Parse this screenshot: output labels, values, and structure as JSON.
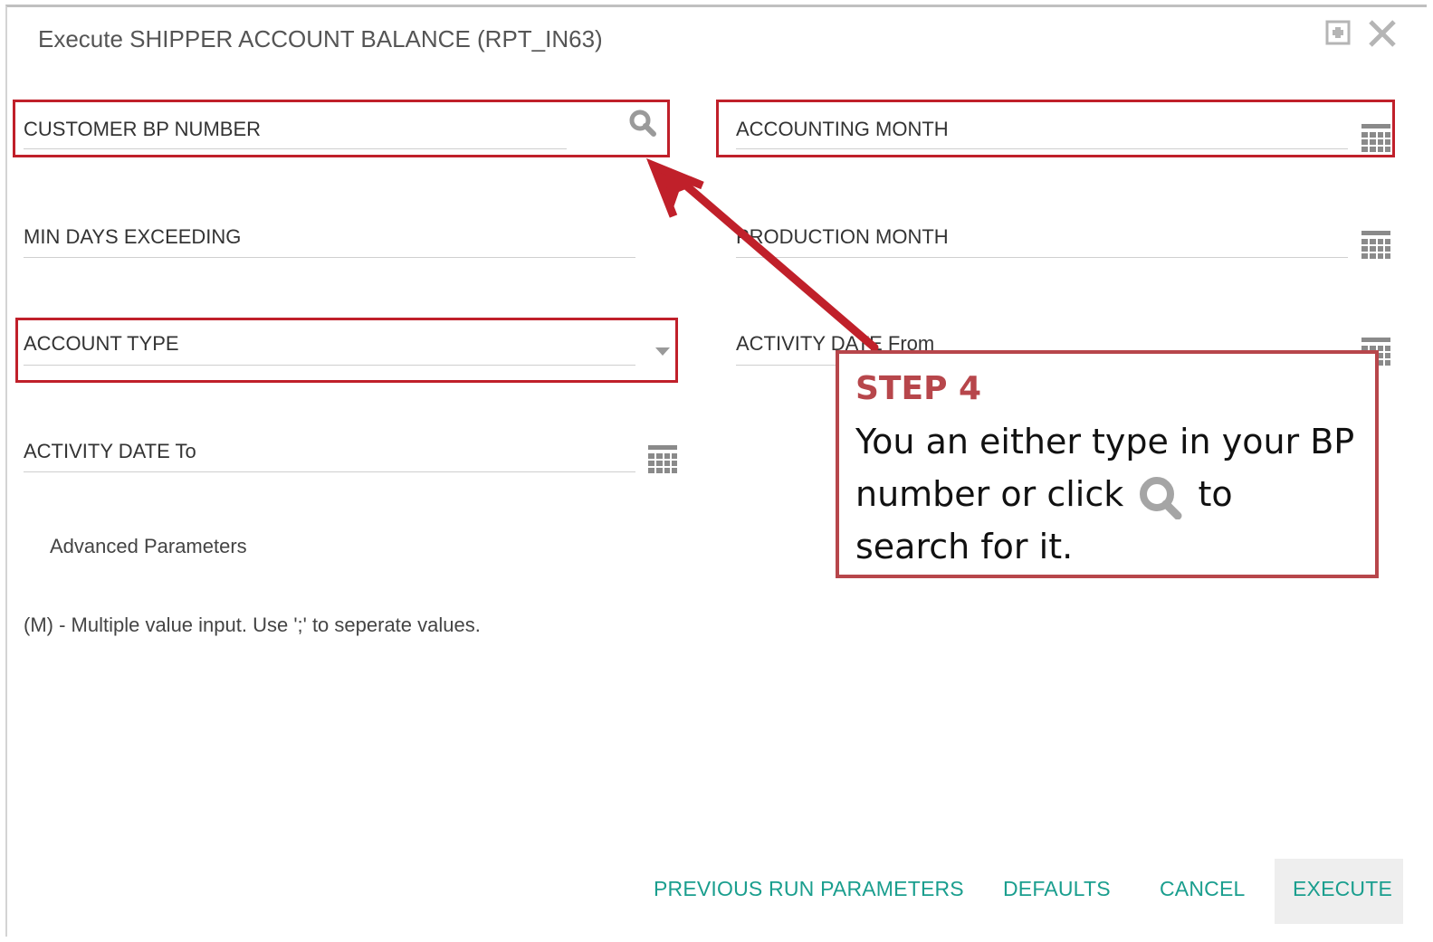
{
  "dialog": {
    "title": "Execute SHIPPER ACCOUNT BALANCE (RPT_IN63)"
  },
  "fields": {
    "customer_bp_number": "CUSTOMER BP NUMBER",
    "accounting_month": "ACCOUNTING MONTH",
    "min_days_exceeding": "MIN DAYS EXCEEDING",
    "production_month": "PRODUCTION MONTH",
    "account_type": "ACCOUNT TYPE",
    "activity_date_from": "ACTIVITY DATE From",
    "activity_date_to": "ACTIVITY DATE To"
  },
  "advanced_parameters": "Advanced Parameters",
  "note": "(M) - Multiple value input. Use ';' to seperate values.",
  "footer": {
    "previous_run_parameters": "PREVIOUS RUN PARAMETERS",
    "defaults": "DEFAULTS",
    "cancel": "CANCEL",
    "execute": "EXECUTE"
  },
  "callout": {
    "step": "STEP 4",
    "line1": "You an either type in your BP",
    "line2_pre": "number or click",
    "line2_post": "to",
    "line3": "search for it."
  },
  "icons": {
    "maximize": "maximize-icon",
    "close": "close-icon",
    "search": "search-icon",
    "calendar": "calendar-icon",
    "dropdown": "chevron-down-icon"
  },
  "colors": {
    "accent": "#1a9e8e",
    "highlight": "#c0202a",
    "callout": "#b7464b"
  }
}
